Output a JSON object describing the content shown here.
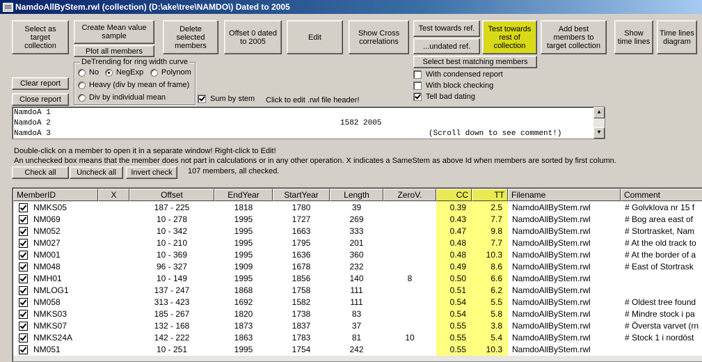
{
  "window": {
    "title": "NamdoAllByStem.rwl (collection)  (D:\\ake\\tree\\NAMDO\\) Dated to 2005"
  },
  "buttons": {
    "select_target": "Select as target collection",
    "create_mean": "Create Mean value sample",
    "plot_all": "Plot all members",
    "delete_selected": "Delete selected members",
    "offset0": "Offset 0 dated to 2005",
    "edit": "Edit",
    "show_cross": "Show Cross correlations",
    "test_ref": "Test towards ref.",
    "undated_ref": "...undated ref.",
    "test_rest": "Test towards rest of collection",
    "add_best": "Add best members to target collection",
    "show_time_lines": "Show time lines",
    "time_lines_diagram": "Time lines diagram",
    "select_best": "Select best matching members",
    "clear_report": "Clear report",
    "close_report": "Close report",
    "check_all": "Check all",
    "uncheck_all": "Uncheck all",
    "invert_check": "Invert check"
  },
  "detrending": {
    "legend": "DeTrending for ring width curve",
    "options": {
      "no": "No",
      "negexp": "NegExp",
      "polynom": "Polynom",
      "heavy": "Heavy (div by mean of frame)",
      "div_individual": "Div by individual mean"
    },
    "selected": "negexp"
  },
  "checks": {
    "condensed": "With condensed report",
    "block": "With block checking",
    "bad_dating": "Tell bad dating",
    "sum_by_stem": "Sum by stem"
  },
  "labels": {
    "click_edit": "Click to edit .rwl file header!",
    "help1": "Double-click on a member to open it in a separate window! Right-click to Edit!",
    "help2": "An unchecked box means that the member does not part in calculations or in any other operation.  X indicates a SameStem as above Id when members are sorted by first column.",
    "member_count": "107 members, all checked."
  },
  "memo": {
    "lines": [
      "NamdoA 1",
      "NamdoA 2",
      "NamdoA 3"
    ],
    "line2_right": "1582 2005",
    "line3_right": "(Scroll down to see comment!)"
  },
  "table": {
    "headers": [
      "MemberID",
      "X",
      "Offset",
      "EndYear",
      "StartYear",
      "Length",
      "ZeroV.",
      "CC",
      "TT",
      "Filename",
      "Comment"
    ],
    "rows": [
      [
        "NMKS05",
        "",
        "187 - 225",
        "1818",
        "1780",
        "39",
        "",
        "0.39",
        "2.5",
        "NamdoAllByStem.rwl",
        "# Golvklova nr 15 f"
      ],
      [
        "NM069",
        "",
        "10 - 278",
        "1995",
        "1727",
        "269",
        "",
        "0.43",
        "7.7",
        "NamdoAllByStem.rwl",
        "# Bog area east of"
      ],
      [
        "NM052",
        "",
        "10 - 342",
        "1995",
        "1663",
        "333",
        "",
        "0.47",
        "9.8",
        "NamdoAllByStem.rwl",
        "# Stortrasket, Nam"
      ],
      [
        "NM027",
        "",
        "10 - 210",
        "1995",
        "1795",
        "201",
        "",
        "0.48",
        "7.7",
        "NamdoAllByStem.rwl",
        "# At the old track to"
      ],
      [
        "NM001",
        "",
        "10 - 369",
        "1995",
        "1636",
        "360",
        "",
        "0.48",
        "10.3",
        "NamdoAllByStem.rwl",
        "# At the border of a"
      ],
      [
        "NM048",
        "",
        "96 - 327",
        "1909",
        "1678",
        "232",
        "",
        "0.49",
        "8.6",
        "NamdoAllByStem.rwl",
        "# East of Stortrask"
      ],
      [
        "NMH01",
        "",
        "10 - 149",
        "1995",
        "1856",
        "140",
        "8",
        "0.50",
        "6.6",
        "NamdoAllByStem.rwl",
        ""
      ],
      [
        "NMLOG1",
        "",
        "137 - 247",
        "1868",
        "1758",
        "111",
        "",
        "0.51",
        "6.2",
        "NamdoAllByStem.rwl",
        ""
      ],
      [
        "NM058",
        "",
        "313 - 423",
        "1692",
        "1582",
        "111",
        "",
        "0.54",
        "5.5",
        "NamdoAllByStem.rwl",
        "# Oldest tree found"
      ],
      [
        "NMKS03",
        "",
        "185 - 267",
        "1820",
        "1738",
        "83",
        "",
        "0.54",
        "5.8",
        "NamdoAllByStem.rwl",
        "# Mindre stock i pa"
      ],
      [
        "NMKS07",
        "",
        "132 - 168",
        "1873",
        "1837",
        "37",
        "",
        "0.55",
        "3.8",
        "NamdoAllByStem.rwl",
        "# Översta varvet (rn"
      ],
      [
        "NMKS24A",
        "",
        "142 - 222",
        "1863",
        "1783",
        "81",
        "10",
        "0.55",
        "5.4",
        "NamdoAllByStem.rwl",
        "# Stock 1 i nordöst"
      ],
      [
        "NM051",
        "",
        "10 - 251",
        "1995",
        "1754",
        "242",
        "",
        "0.55",
        "10.3",
        "NamdoAllByStem.rwl",
        ""
      ]
    ]
  },
  "colors": {
    "highlight_button": "#d9d918",
    "highlight_column": "#ffff80",
    "titlebar": "#0a246a"
  }
}
